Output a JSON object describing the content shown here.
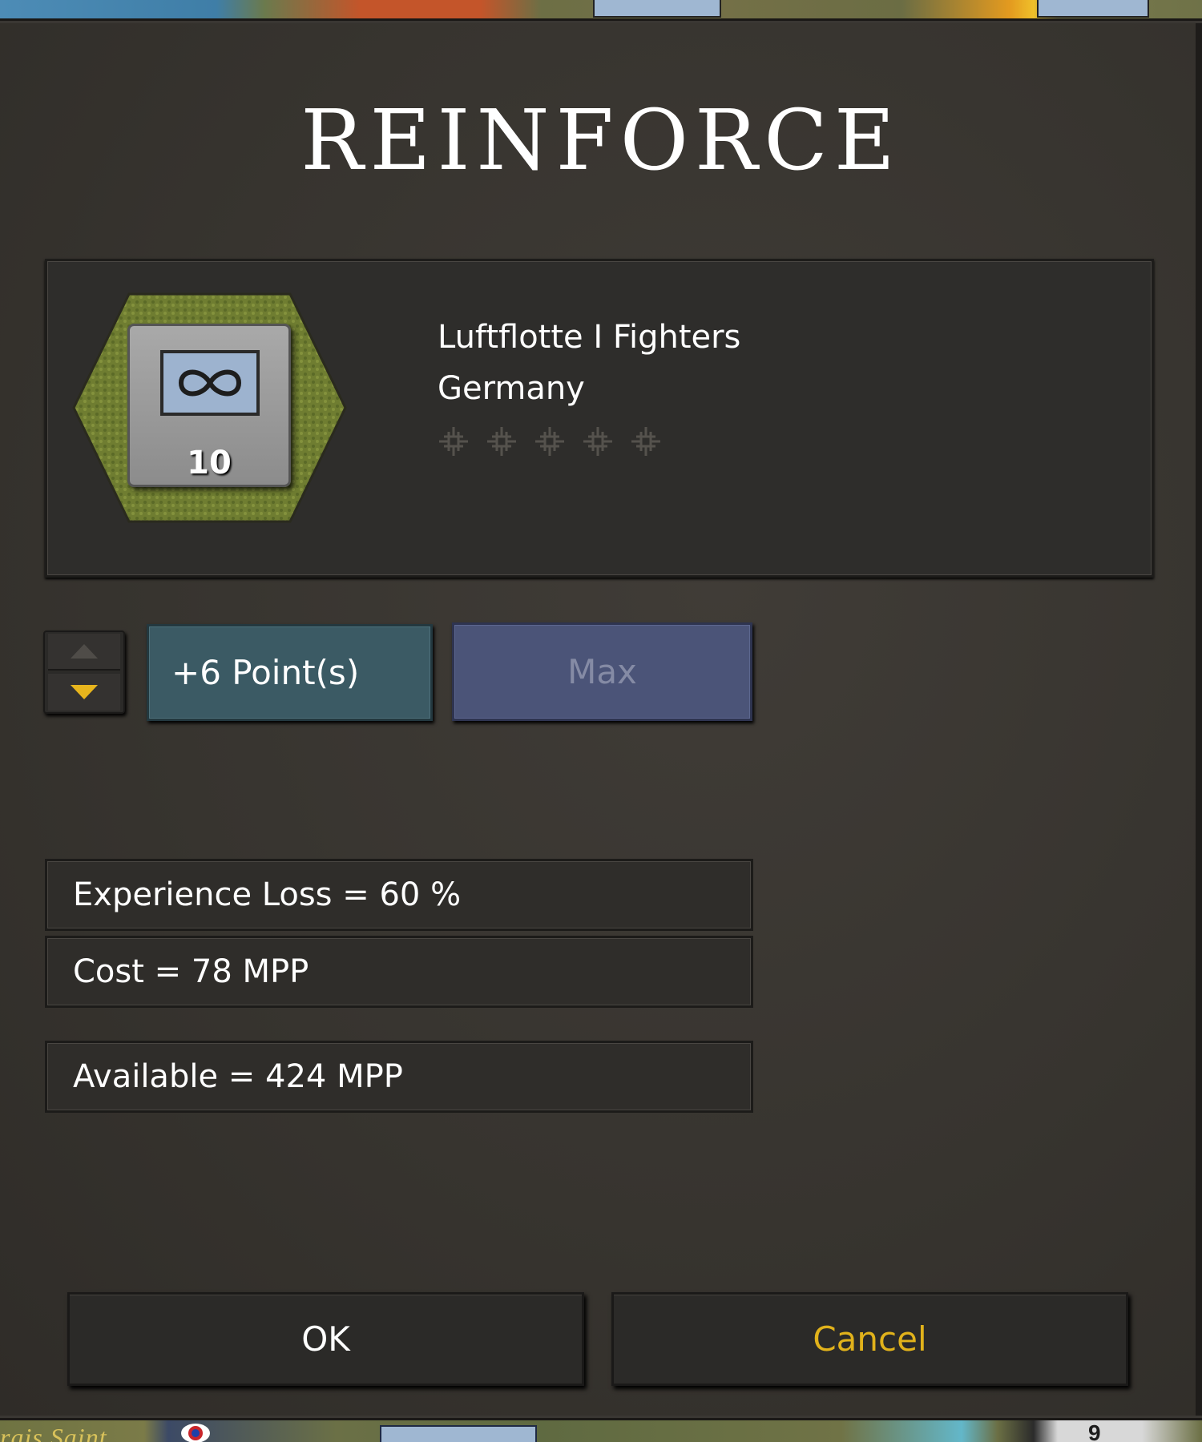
{
  "dialog": {
    "title": "REINFORCE"
  },
  "unit": {
    "name": "Luftflotte I Fighters",
    "nation": "Germany",
    "strength": "10",
    "counter_icon": "infinity-symbol-icon",
    "experience_icons": [
      "iron-cross-icon",
      "iron-cross-icon",
      "iron-cross-icon",
      "iron-cross-icon",
      "iron-cross-icon"
    ],
    "experience_filled": 0
  },
  "controls": {
    "points_label": "+6 Point(s)",
    "max_label": "Max",
    "spinner_up_icon": "triangle-up-icon",
    "spinner_down_icon": "triangle-down-icon"
  },
  "info": {
    "experience_loss": "Experience Loss = 60 %",
    "cost": "Cost = 78 MPP",
    "available": "Available = 424 MPP"
  },
  "buttons": {
    "ok": "OK",
    "cancel": "Cancel"
  },
  "map_bottom": {
    "label": "rais Saint",
    "count": "9"
  },
  "colors": {
    "background": "#3a3733",
    "title": "#ffffff",
    "cancel_text": "#e1b21b",
    "points_box": "#3b5a64",
    "max_button": "#4b5478",
    "hex_terrain": "#6f7d31"
  }
}
